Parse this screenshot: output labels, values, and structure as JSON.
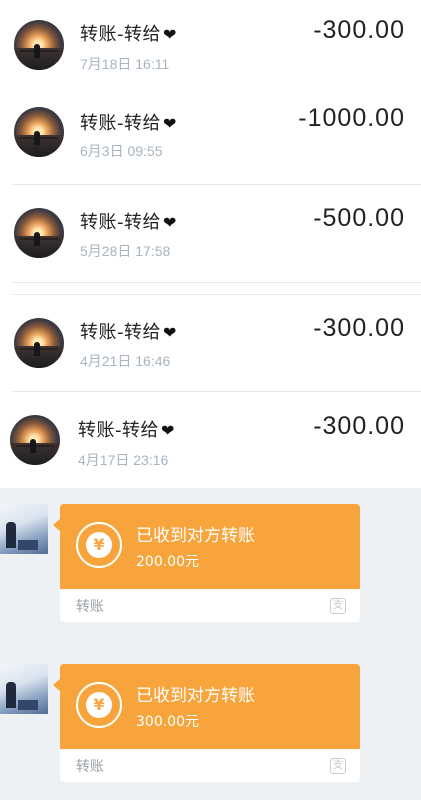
{
  "transactions": [
    {
      "title": "转账-转给",
      "heart": "❤",
      "date": "7月18日 16:11",
      "amount": "-300.00"
    },
    {
      "title": "转账-转给",
      "heart": "❤",
      "date": "6月3日 09:55",
      "amount": "-1000.00"
    },
    {
      "title": "转账-转给",
      "heart": "❤",
      "date": "5月28日 17:58",
      "amount": "-500.00"
    },
    {
      "title": "转账-转给",
      "heart": "❤",
      "date": "4月21日 16:46",
      "amount": "-300.00"
    },
    {
      "title": "转账-转给",
      "heart": "❤",
      "date": "4月17日 23:16",
      "amount": "-300.00"
    }
  ],
  "messages": [
    {
      "headline": "已收到对方转账",
      "amount": "200.00元",
      "label": "转账",
      "icon": "yuan-transfer-icon"
    },
    {
      "headline": "已收到对方转账",
      "amount": "300.00元",
      "label": "转账",
      "icon": "yuan-transfer-icon"
    }
  ],
  "colors": {
    "bubble": "#f6a43b",
    "chat_bg": "#eef1f3",
    "date": "#a8b4bf"
  }
}
